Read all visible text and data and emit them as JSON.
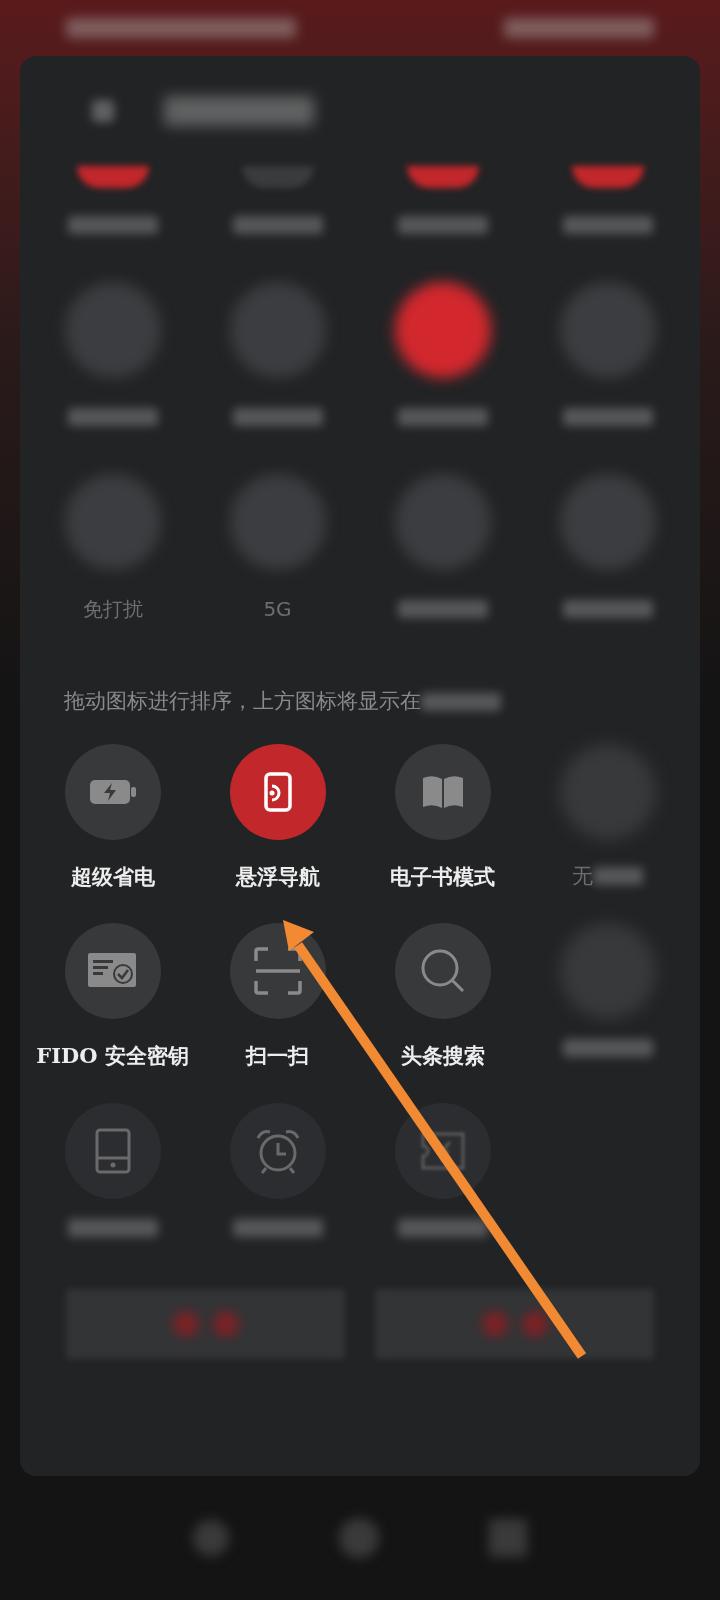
{
  "active_tiles": [
    {
      "on": true,
      "kind": "cut"
    },
    {
      "on": false,
      "kind": "cut"
    },
    {
      "on": true,
      "kind": "cut"
    },
    {
      "on": true,
      "kind": "cut"
    },
    {
      "on": false,
      "kind": "blurred"
    },
    {
      "on": false,
      "kind": "blurred"
    },
    {
      "on": true,
      "kind": "blurred"
    },
    {
      "on": false,
      "kind": "blurred"
    },
    {
      "on": false,
      "kind": "blurred",
      "label": "免打扰"
    },
    {
      "on": false,
      "kind": "blurred",
      "label": "5G"
    },
    {
      "on": false,
      "kind": "blurred"
    },
    {
      "on": false,
      "kind": "blurred"
    }
  ],
  "hint": "拖动图标进行排序，上方图标将显示在",
  "available_tiles": [
    {
      "on": false,
      "kind": "battery",
      "label": "超级省电"
    },
    {
      "on": true,
      "kind": "floating",
      "label": "悬浮导航"
    },
    {
      "on": false,
      "kind": "book",
      "label": "电子书模式"
    },
    {
      "on": false,
      "kind": "blurred",
      "label": "无"
    },
    {
      "on": false,
      "kind": "card",
      "label": "FIDO 安全密钥"
    },
    {
      "on": false,
      "kind": "scan",
      "label": "扫一扫"
    },
    {
      "on": false,
      "kind": "search",
      "label": "头条搜索"
    },
    {
      "on": false,
      "kind": "blurred"
    },
    {
      "on": false,
      "kind": "phone"
    },
    {
      "on": false,
      "kind": "alarm"
    },
    {
      "on": false,
      "kind": "ticket"
    }
  ]
}
